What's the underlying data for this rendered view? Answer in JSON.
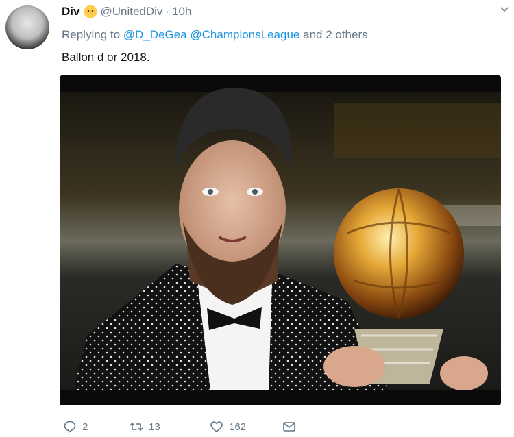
{
  "tweet": {
    "display_name": "Div",
    "handle": "@UnitedDiv",
    "separator": "·",
    "time": "10h",
    "replying_prefix": "Replying to",
    "reply_mentions": [
      "@D_DeGea",
      "@ChampionsLeague"
    ],
    "reply_suffix": "and 2 others",
    "text": "Ballon d or 2018."
  },
  "actions": {
    "reply_count": "2",
    "retweet_count": "13",
    "like_count": "162"
  },
  "icons": {
    "avatar": "avatar-icon",
    "emoji": "emoji-icon",
    "chevron": "chevron-down-icon",
    "reply": "reply-icon",
    "retweet": "retweet-icon",
    "like": "heart-icon",
    "dm": "envelope-icon"
  },
  "colors": {
    "text": "#14171a",
    "secondary": "#657786",
    "link": "#1b95e0"
  }
}
